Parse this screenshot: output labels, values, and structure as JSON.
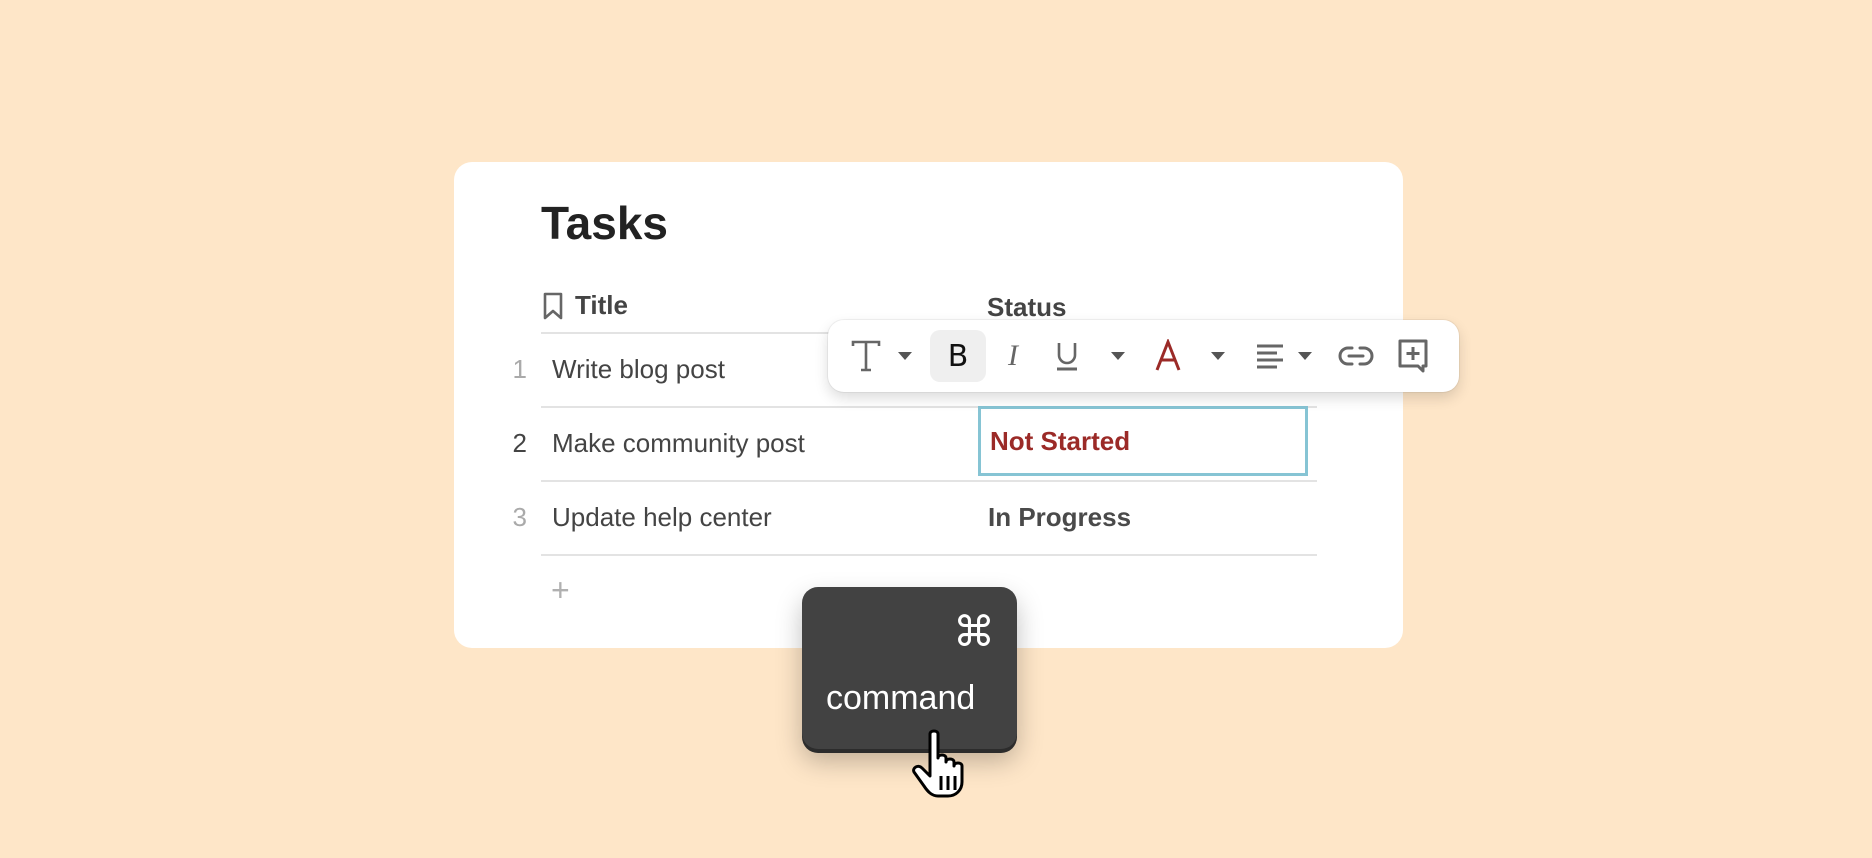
{
  "page": {
    "title": "Tasks"
  },
  "table": {
    "columns": [
      {
        "label": "Title",
        "icon": "bookmark-icon"
      },
      {
        "label": "Status"
      }
    ],
    "rows": [
      {
        "num": "1",
        "title": "Write blog post",
        "status": ""
      },
      {
        "num": "2",
        "title": "Make community post",
        "status": "Not Started"
      },
      {
        "num": "3",
        "title": "Update help center",
        "status": "In Progress"
      }
    ],
    "add_row": "+"
  },
  "toolbar": {
    "items": [
      "text-type",
      "bold",
      "italic",
      "underline",
      "text-color",
      "align",
      "link",
      "add-comment"
    ],
    "text_color": "#9b2a27"
  },
  "key": {
    "symbol": "⌘",
    "label": "command"
  },
  "colors": {
    "background": "#fee6c8",
    "selected_border": "#86c4d4",
    "not_started": "#9b2a27"
  }
}
